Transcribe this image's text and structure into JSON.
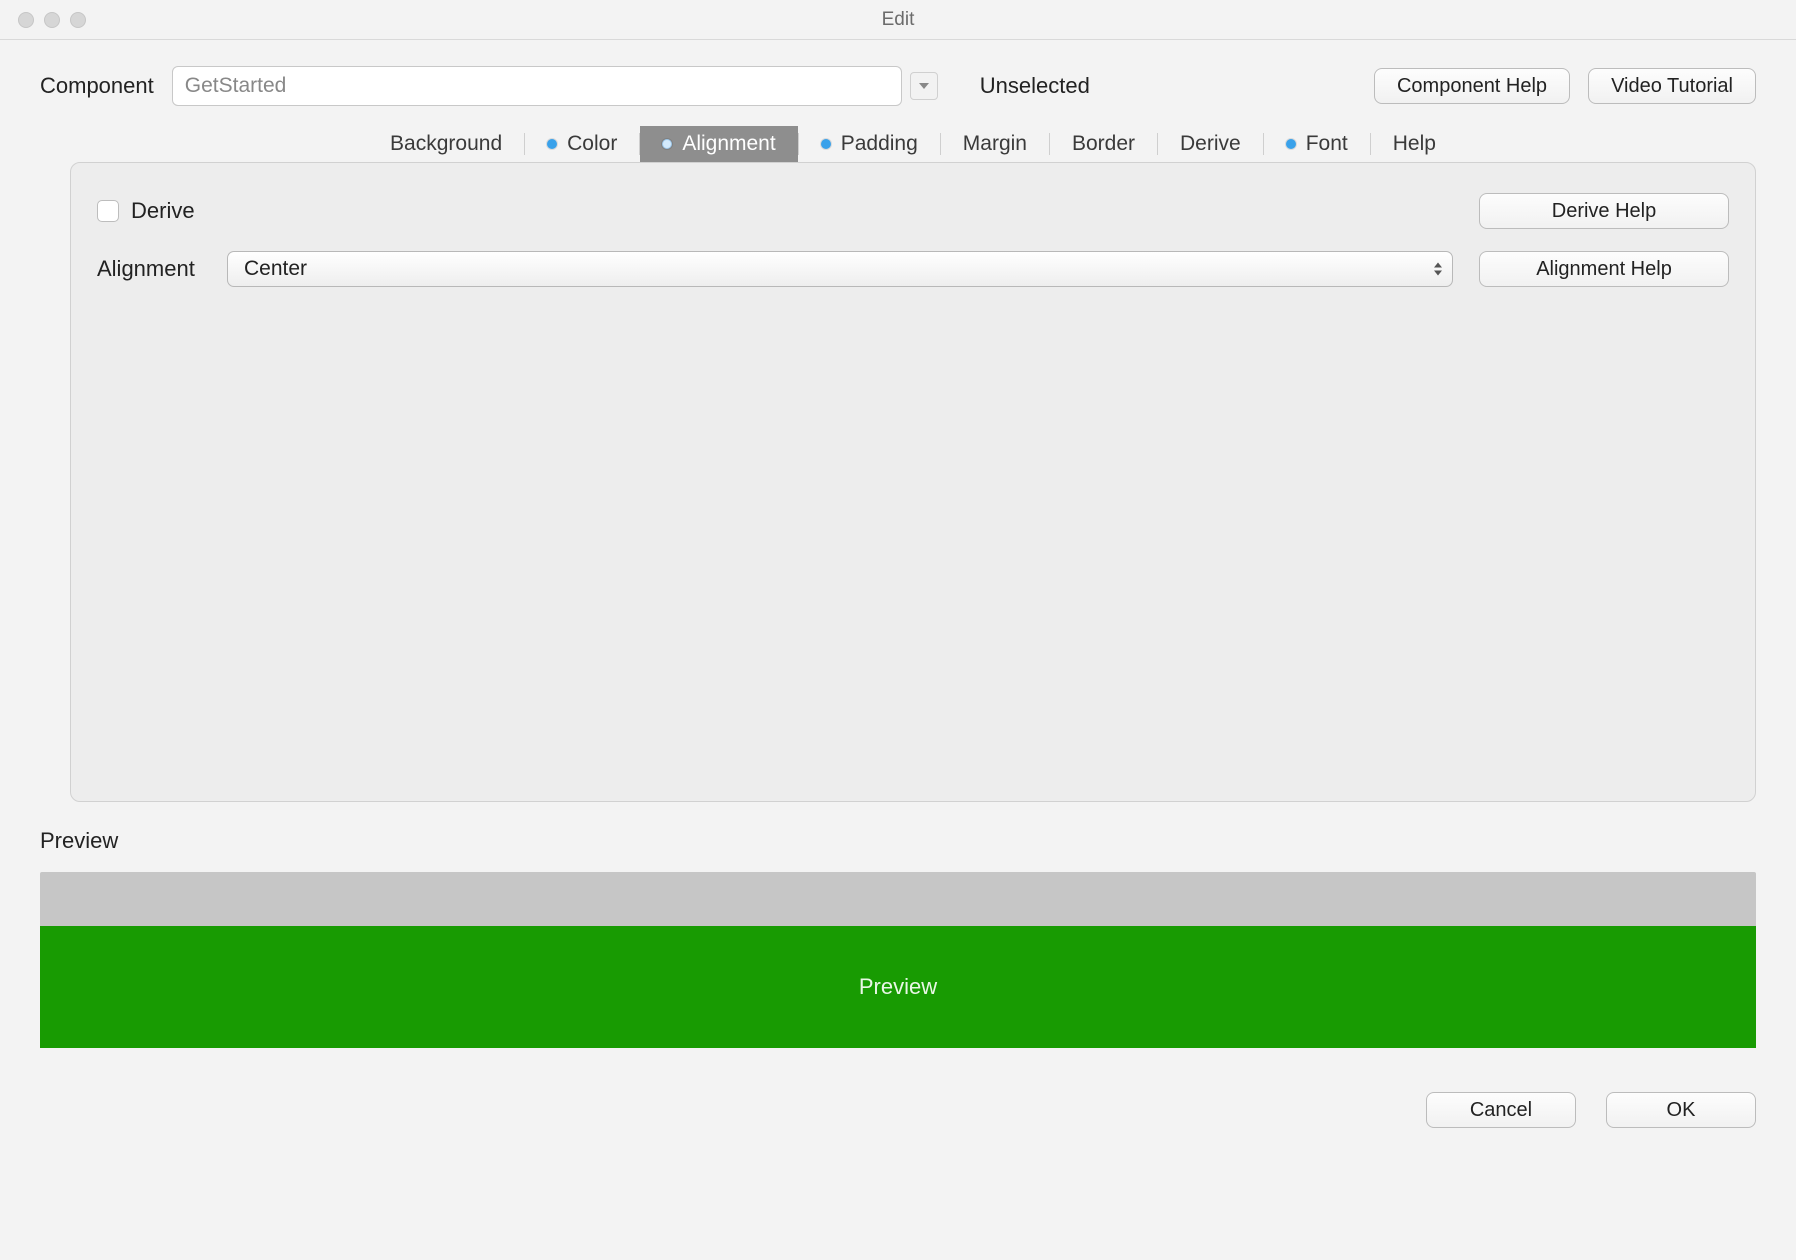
{
  "window": {
    "title": "Edit"
  },
  "top": {
    "component_label": "Component",
    "component_value": "GetStarted",
    "unselected_label": "Unselected",
    "component_help": "Component Help",
    "video_tutorial": "Video Tutorial"
  },
  "tabs": {
    "background": "Background",
    "color": "Color",
    "alignment": "Alignment",
    "padding": "Padding",
    "margin": "Margin",
    "border": "Border",
    "derive": "Derive",
    "font": "Font",
    "help": "Help",
    "selected": "Alignment"
  },
  "panel": {
    "derive_label": "Derive",
    "derive_checked": false,
    "derive_help": "Derive Help",
    "alignment_label": "Alignment",
    "alignment_value": "Center",
    "alignment_help": "Alignment Help"
  },
  "preview": {
    "section_label": "Preview",
    "inner_text": "Preview",
    "color": "#189b02"
  },
  "footer": {
    "cancel": "Cancel",
    "ok": "OK"
  }
}
